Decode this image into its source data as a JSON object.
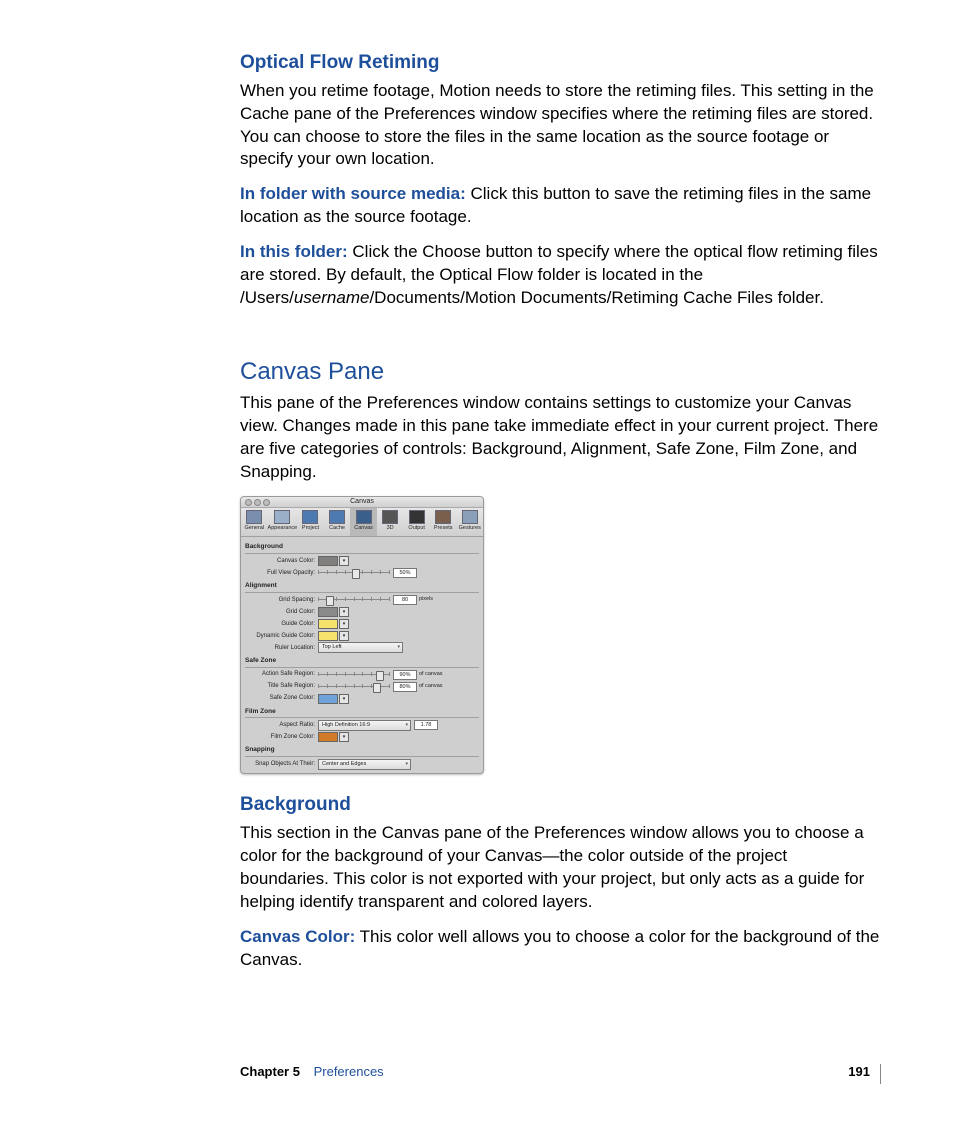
{
  "sections": {
    "optical": {
      "heading": "Optical Flow Retiming",
      "body": "When you retime footage, Motion needs to store the retiming files. This setting in the Cache pane of the Preferences window specifies where the retiming files are stored. You can choose to store the files in the same location as the source footage or specify your own location.",
      "p2_label": "In folder with source media:",
      "p2_body": "  Click this button to save the retiming files in the same location as the source footage.",
      "p3_label": "In this folder:",
      "p3_body": "  Click the Choose button to specify where the optical flow retiming files are stored. By default, the Optical Flow folder is located in the ",
      "p3_path_pre": "/Users/",
      "p3_path_user": "username",
      "p3_path_post": "/Documents/Motion Documents/Retiming Cache Files folder."
    },
    "canvas": {
      "heading": "Canvas Pane",
      "body": "This pane of the Preferences window contains settings to customize your Canvas view. Changes made in this pane take immediate effect in your current project. There are five categories of controls: Background, Alignment, Safe Zone, Film Zone, and Snapping."
    },
    "background": {
      "heading": "Background",
      "body": "This section in the Canvas pane of the Preferences window allows you to choose a color for the background of your Canvas—the color outside of the project boundaries. This color is not exported with your project, but only acts as a guide for helping identify transparent and colored layers.",
      "p2_label": "Canvas Color:",
      "p2_body": "  This color well allows you to choose a color for the background of the Canvas."
    }
  },
  "prefs_window": {
    "title": "Canvas",
    "tabs": [
      "General",
      "Appearance",
      "Project",
      "Cache",
      "Canvas",
      "3D",
      "Output",
      "Presets",
      "Gestures"
    ],
    "selected_tab": "Canvas",
    "background_section": {
      "header": "Background",
      "canvas_color_label": "Canvas Color:",
      "full_view_opacity_label": "Full View Opacity:",
      "full_view_opacity_value": "50%"
    },
    "alignment_section": {
      "header": "Alignment",
      "grid_spacing_label": "Grid Spacing:",
      "grid_spacing_value": "80",
      "grid_spacing_unit": "pixels",
      "grid_color_label": "Grid Color:",
      "guide_color_label": "Guide Color:",
      "dynamic_guide_color_label": "Dynamic Guide Color:",
      "ruler_location_label": "Ruler Location:",
      "ruler_location_value": "Top Left"
    },
    "safe_zone_section": {
      "header": "Safe Zone",
      "action_safe_label": "Action Safe Region:",
      "action_safe_value": "90%",
      "action_safe_unit": "of canvas",
      "title_safe_label": "Title Safe Region:",
      "title_safe_value": "80%",
      "title_safe_unit": "of canvas",
      "safe_zone_color_label": "Safe Zone Color:"
    },
    "film_zone_section": {
      "header": "Film Zone",
      "aspect_ratio_label": "Aspect Ratio:",
      "aspect_ratio_value": "High Definition 16:9",
      "aspect_ratio_num": "1.78",
      "film_zone_color_label": "Film Zone Color:"
    },
    "snapping_section": {
      "header": "Snapping",
      "snap_label": "Snap Objects At Their:",
      "snap_value": "Center and Edges"
    }
  },
  "footer": {
    "chapter_label": "Chapter 5",
    "chapter_title": "Preferences",
    "page": "191"
  }
}
